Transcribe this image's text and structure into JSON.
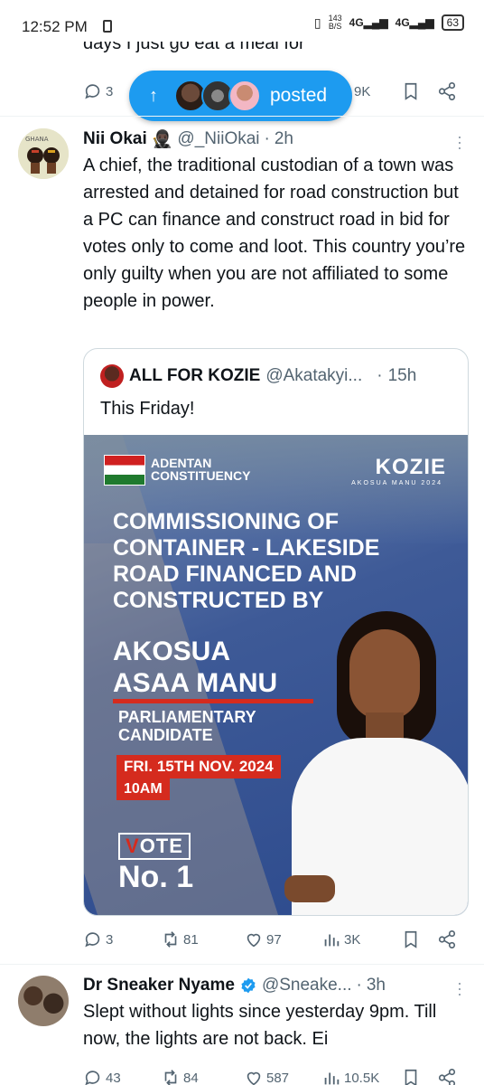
{
  "status_bar": {
    "time": "12:52 PM",
    "speed_value": "143",
    "speed_unit": "B/S",
    "net1": "4G",
    "net2": "4G",
    "battery": "63"
  },
  "previous_tweet": {
    "text_fragment": "days I just go eat a meal for",
    "reply_count": "3",
    "view_count": "9K"
  },
  "posted_pill": {
    "label": "posted",
    "arrow": "↑"
  },
  "tweet1": {
    "name": "Nii Okai",
    "badge_emoji": "🥷🏿",
    "handle": "@_NiiOkai",
    "separator": "·",
    "time": "2h",
    "avatar_label": "GHANA",
    "text": "A chief, the  traditional custodian of a town was arrested and detained for road construction but a PC can finance and construct road in bid for votes only to come and loot. This country you’re only guilty when you are not affiliated to some people in power.",
    "quote": {
      "name": "ALL FOR KOZIE",
      "handle": "@Akatakyi...",
      "separator": "·",
      "time": "15h",
      "text": "This Friday!",
      "poster": {
        "constituency_line1": "ADENTAN",
        "constituency_line2": "CONSTITUENCY",
        "brand": "KOZIE",
        "brand_sub": "AKOSUA MANU 2024",
        "headline_lines": [
          "COMMISSIONING OF",
          "CONTAINER - LAKESIDE",
          "ROAD FINANCED AND",
          "CONSTRUCTED BY"
        ],
        "candidate_line1": "AKOSUA",
        "candidate_line2": "ASAA MANU",
        "role_line1": "PARLIAMENTARY",
        "role_line2": "CANDIDATE",
        "date": "FRI. 15TH NOV. 2024",
        "time": "10AM",
        "vote_v": "V",
        "vote_rest": "OTE",
        "number": "No. 1"
      }
    },
    "stats": {
      "replies": "3",
      "reposts": "81",
      "likes": "97",
      "views": "3K"
    }
  },
  "tweet2": {
    "name": "Dr Sneaker Nyame",
    "handle": "@Sneake...",
    "separator": "·",
    "time": "3h",
    "text": "Slept without lights since yesterday 9pm. Till now, the lights are not back. Ei",
    "stats": {
      "replies": "43",
      "reposts": "84",
      "likes": "587",
      "views": "10.5K"
    }
  },
  "colors": {
    "accent": "#1d9bf0",
    "muted": "#536471",
    "text": "#0f1419",
    "border": "#cfd9de",
    "verified": "#1d9bf0",
    "ndc_red": "#d52b1e"
  },
  "icons": [
    "reply-icon",
    "repost-icon",
    "like-icon",
    "views-icon",
    "bookmark-icon",
    "share-icon",
    "verified-icon",
    "more-icon"
  ]
}
